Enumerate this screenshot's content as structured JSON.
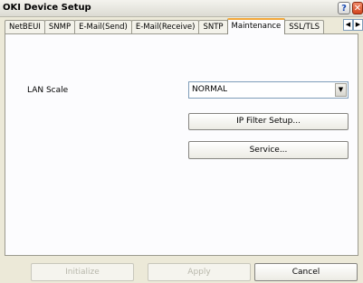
{
  "window": {
    "title": "OKI Device Setup",
    "help_glyph": "?",
    "close_glyph": "✕"
  },
  "tabs": [
    {
      "label": "NetBEUI",
      "active": false
    },
    {
      "label": "SNMP",
      "active": false
    },
    {
      "label": "E-Mail(Send)",
      "active": false
    },
    {
      "label": "E-Mail(Receive)",
      "active": false
    },
    {
      "label": "SNTP",
      "active": false
    },
    {
      "label": "Maintenance",
      "active": true
    },
    {
      "label": "SSL/TLS",
      "active": false
    }
  ],
  "tab_scroll": {
    "left": "◀",
    "right": "▶"
  },
  "maintenance": {
    "lan_scale_label": "LAN Scale",
    "lan_scale_value": "NORMAL",
    "ip_filter_button": "IP Filter Setup...",
    "service_button": "Service..."
  },
  "footer": {
    "initialize": "Initialize",
    "apply": "Apply",
    "cancel": "Cancel"
  },
  "colors": {
    "window_bg": "#ece9d8",
    "active_tab_accent": "#f2a73a",
    "close_button": "#d2451f"
  },
  "icons": {
    "help": "help-icon",
    "close": "close-icon",
    "dropdown": "chevron-down-icon"
  }
}
